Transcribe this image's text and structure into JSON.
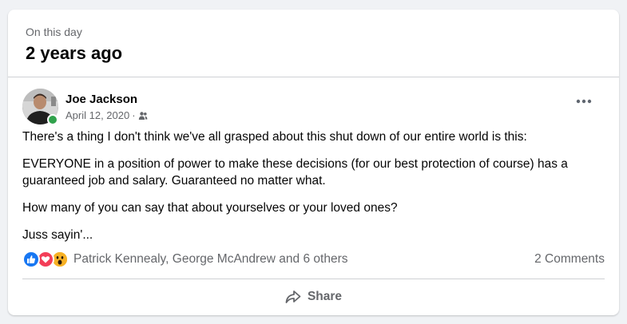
{
  "memory": {
    "kicker": "On this day",
    "title": "2 years ago"
  },
  "post": {
    "author": "Joe Jackson",
    "date": "April 12, 2020",
    "separator": "·",
    "audience_icon": "friends-icon",
    "paragraphs": [
      "There's a thing I don't think we've all grasped about this shut down of our entire world is this:",
      "EVERYONE in a position of power to make these decisions (for our best protection of course) has a guaranteed job and salary. Guaranteed no matter what.",
      "How many of you can say that about yourselves or your loved ones?",
      "Juss sayin'..."
    ]
  },
  "reactions": {
    "icons": [
      "like-icon",
      "love-icon",
      "wow-icon"
    ],
    "reactors_text": "Patrick Kennealy, George McAndrew and 6 others",
    "comments_text": "2 Comments"
  },
  "actions": {
    "share_label": "Share"
  },
  "colors": {
    "background": "#f0f2f5",
    "card": "#ffffff",
    "secondary_text": "#65676b",
    "like": "#1877f2",
    "love": "#f33e58",
    "wow": "#f7b125",
    "online": "#31a24c"
  }
}
